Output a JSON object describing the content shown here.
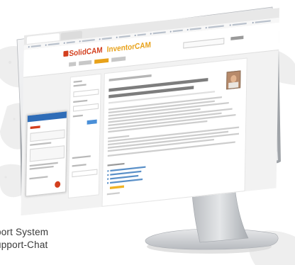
{
  "site": {
    "brand_primary": "SolidCAM",
    "brand_secondary": "InventorCAM"
  },
  "caption": {
    "line1": "port System",
    "line2": "upport-Chat"
  },
  "colors": {
    "brand_red": "#d33f1e",
    "brand_orange": "#e8a21a",
    "link_blue": "#5a90c8",
    "monitor_silver": "#cfd2d6"
  }
}
